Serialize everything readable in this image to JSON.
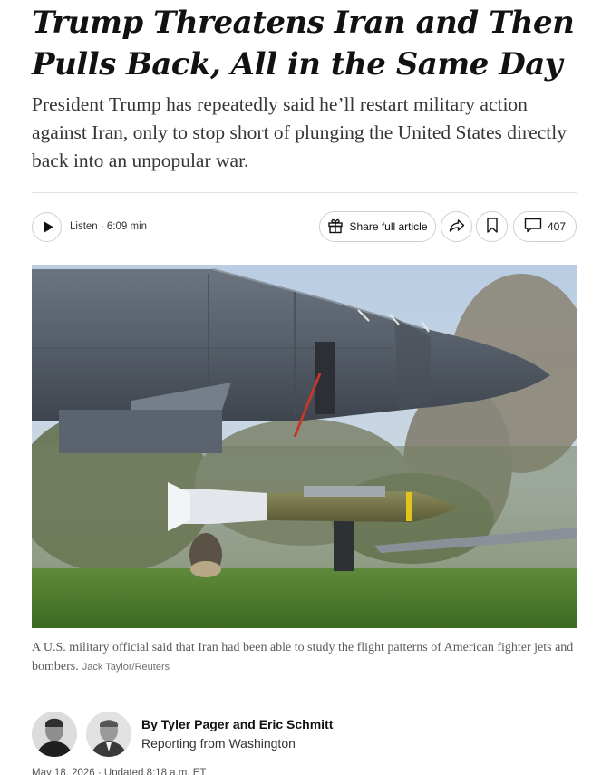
{
  "article": {
    "headline": "Trump Threatens Iran and Then Pulls Back, All in the Same Day",
    "summary": "President Trump has repeatedly said he’ll restart military action against Iran, only to stop short of plunging the United States directly back into an unpopular war."
  },
  "toolbar": {
    "listen_label": "Listen · 6:09 min",
    "share_label": "Share full article",
    "comment_count": "407"
  },
  "photo": {
    "caption": "A U.S. military official said that Iran had been able to study the flight patterns of American fighter jets and bombers.",
    "credit": "Jack Taylor/Reuters"
  },
  "byline": {
    "prefix": "By",
    "author_1": "Tyler Pager",
    "conjunction": "and",
    "author_2": "Eric Schmitt",
    "dateline": "Reporting from Washington"
  },
  "timestamp": "May 18, 2026 · Updated 8:18 a.m. ET",
  "icons": [
    "play-icon",
    "gift-icon",
    "share-arrow-icon",
    "bookmark-icon",
    "comment-icon"
  ]
}
